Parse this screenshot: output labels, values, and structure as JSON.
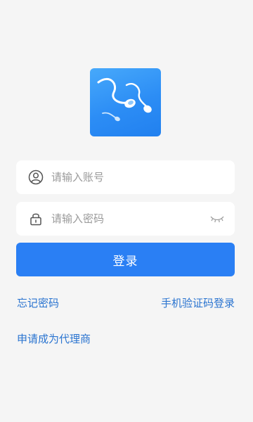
{
  "logo": {
    "icon": "sperm-logo-icon",
    "colors": {
      "background": "#2c8df5",
      "mark": "#ffffff"
    }
  },
  "login_form": {
    "account": {
      "icon": "user-icon",
      "placeholder": "请输入账号",
      "value": ""
    },
    "password": {
      "icon": "lock-icon",
      "placeholder": "请输入密码",
      "value": "",
      "toggle_icon": "eye-closed-icon"
    },
    "submit_label": "登录"
  },
  "links": {
    "forgot_password": "忘记密码",
    "sms_login": "手机验证码登录",
    "apply_agent": "申请成为代理商"
  },
  "colors": {
    "primary": "#2a7ff4",
    "link": "#2a74d0",
    "page_background": "#f5f5f5",
    "field_background": "#ffffff",
    "placeholder": "#9a9a9a"
  }
}
